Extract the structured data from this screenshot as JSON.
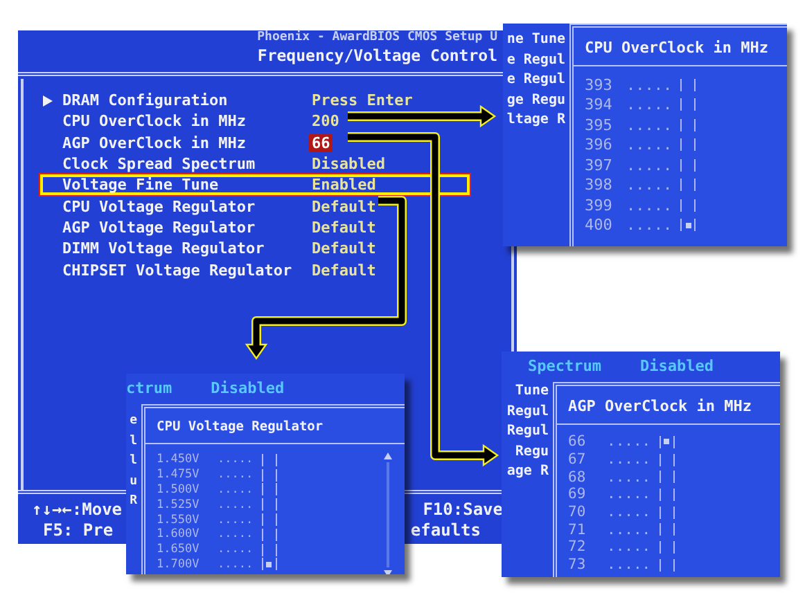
{
  "bios": {
    "header": "Phoenix - AwardBIOS CMOS Setup U",
    "title": "Frequency/Voltage Control",
    "items": [
      {
        "label": "DRAM Configuration",
        "value": "Press Enter",
        "submenu": true,
        "selected": false,
        "highlighted": false
      },
      {
        "label": "CPU OverClock in MHz",
        "value": "200",
        "submenu": false,
        "selected": false,
        "highlighted": false
      },
      {
        "label": "AGP OverClock in MHz",
        "value": "66",
        "submenu": false,
        "selected": false,
        "highlighted": true
      },
      {
        "label": "Clock Spread Spectrum",
        "value": "Disabled",
        "submenu": false,
        "selected": false,
        "highlighted": false
      },
      {
        "label": "Voltage Fine Tune",
        "value": "Enabled",
        "submenu": false,
        "selected": true,
        "highlighted": false
      },
      {
        "label": "CPU Voltage Regulator",
        "value": "Default",
        "submenu": false,
        "selected": false,
        "highlighted": false
      },
      {
        "label": "AGP Voltage Regulator",
        "value": "Default",
        "submenu": false,
        "selected": false,
        "highlighted": false
      },
      {
        "label": "DIMM Voltage Regulator",
        "value": "Default",
        "submenu": false,
        "selected": false,
        "highlighted": false
      },
      {
        "label": "CHIPSET Voltage Regulator",
        "value": "Default",
        "submenu": false,
        "selected": false,
        "highlighted": false
      }
    ],
    "footer": [
      {
        "left": "↑↓→←:Move",
        "right": "F10:Save"
      },
      {
        "left": "F5: Pre",
        "right": "efaults"
      }
    ]
  },
  "panels": [
    {
      "left": [
        "ne Tune",
        "e Regul",
        "e Regul",
        "ge Regu",
        "ltage R"
      ],
      "popup": {
        "title": "CPU OverClock in MHz",
        "scrollbar": false,
        "options": [
          {
            "value": "393",
            "dots": ".....",
            "selected": false
          },
          {
            "value": "394",
            "dots": ".....",
            "selected": false
          },
          {
            "value": "395",
            "dots": ".....",
            "selected": false
          },
          {
            "value": "396",
            "dots": ".....",
            "selected": false
          },
          {
            "value": "397",
            "dots": ".....",
            "selected": false
          },
          {
            "value": "398",
            "dots": ".....",
            "selected": false
          },
          {
            "value": "399",
            "dots": ".....",
            "selected": false
          },
          {
            "value": "400",
            "dots": ".....",
            "selected": true
          }
        ]
      }
    },
    {
      "top": [
        "ctrum",
        "Disabled"
      ],
      "left": [
        "e",
        "l",
        "l",
        "u",
        "R"
      ],
      "popup": {
        "title": "CPU Voltage Regulator",
        "scrollbar": true,
        "options": [
          {
            "value": "1.450V",
            "dots": ".....",
            "selected": false
          },
          {
            "value": "1.475V",
            "dots": ".....",
            "selected": false
          },
          {
            "value": "1.500V",
            "dots": ".....",
            "selected": false
          },
          {
            "value": "1.525V",
            "dots": ".....",
            "selected": false
          },
          {
            "value": "1.550V",
            "dots": ".....",
            "selected": false
          },
          {
            "value": "1.600V",
            "dots": ".....",
            "selected": false
          },
          {
            "value": "1.650V",
            "dots": ".....",
            "selected": false
          },
          {
            "value": "1.700V",
            "dots": ".....",
            "selected": true
          }
        ]
      }
    },
    {
      "top": [
        "Spectrum",
        "Disabled"
      ],
      "left": [
        "Tune",
        "Regul",
        "Regul",
        "Regu",
        "age R"
      ],
      "popup": {
        "title": "AGP OverClock in MHz",
        "scrollbar": false,
        "options": [
          {
            "value": "66",
            "dots": ".....",
            "selected": true
          },
          {
            "value": "67",
            "dots": ".....",
            "selected": false
          },
          {
            "value": "68",
            "dots": ".....",
            "selected": false
          },
          {
            "value": "69",
            "dots": ".....",
            "selected": false
          },
          {
            "value": "70",
            "dots": ".....",
            "selected": false
          },
          {
            "value": "71",
            "dots": ".....",
            "selected": false
          },
          {
            "value": "72",
            "dots": ".....",
            "selected": false
          },
          {
            "value": "73",
            "dots": ".....",
            "selected": false
          }
        ]
      }
    }
  ]
}
